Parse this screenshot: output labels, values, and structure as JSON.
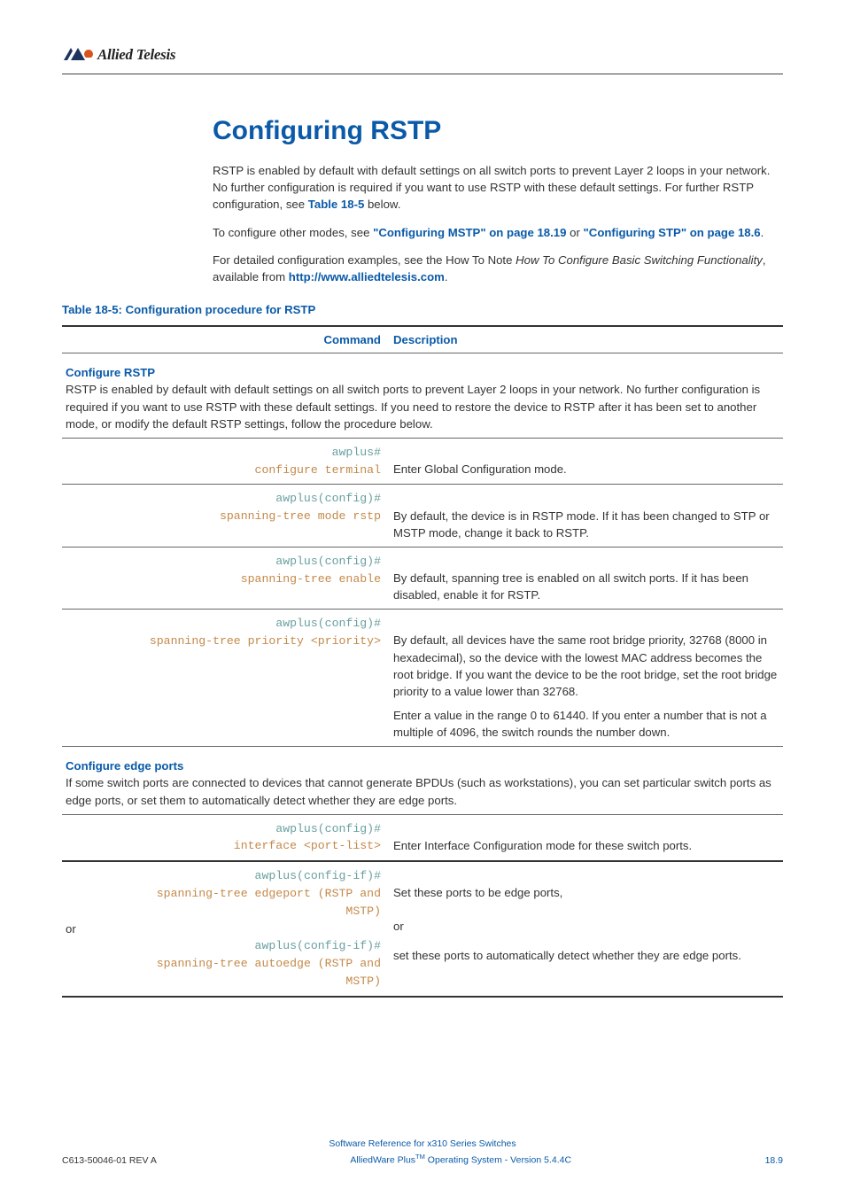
{
  "logo_text": "Allied Telesis",
  "h1": "Configuring RSTP",
  "intro": {
    "p1_a": "RSTP is enabled by default with default settings on all switch ports to prevent Layer 2 loops in your network. No further configuration is required if you want to use RSTP with these default settings. For further RSTP configuration, see ",
    "p1_link": "Table 18-5",
    "p1_b": " below.",
    "p2_a": "To configure other modes, see ",
    "p2_link1": "\"Configuring MSTP\" on page 18.19",
    "p2_b": " or ",
    "p2_link2": "\"Configuring STP\" on page 18.6",
    "p2_c": ".",
    "p3_a": "For detailed configuration examples, see the How To Note ",
    "p3_i": "How To Configure Basic Switching Functionality",
    "p3_b": ", available from ",
    "p3_link": "http://www.alliedtelesis.com",
    "p3_c": "."
  },
  "table_caption": "Table 18-5: Configuration procedure for RSTP",
  "head": {
    "cmd": "Command",
    "desc": "Description"
  },
  "sec1": {
    "title": "Configure RSTP",
    "body": "RSTP is enabled by default with default settings on all switch ports to prevent Layer 2 loops in your network. No further configuration is required if you want to use RSTP with these default settings. If you need to restore the device to RSTP after it has been set to another mode, or modify the default RSTP settings, follow the procedure below."
  },
  "rows": {
    "r1": {
      "prompt": "awplus#",
      "cmd": "configure terminal",
      "desc": "Enter Global Configuration mode."
    },
    "r2": {
      "prompt": "awplus(config)#",
      "cmd": "spanning-tree mode rstp",
      "desc": "By default, the device is in RSTP mode. If it has been changed to STP or MSTP mode, change it back to RSTP."
    },
    "r3": {
      "prompt": "awplus(config)#",
      "cmd": "spanning-tree enable",
      "desc": "By default, spanning tree is enabled on all switch ports. If it has been disabled, enable it for RSTP."
    },
    "r4": {
      "prompt": "awplus(config)#",
      "cmd": "spanning-tree priority <priority>",
      "desc1": "By default, all devices have the same root bridge priority, 32768 (8000 in hexadecimal), so the device with the lowest MAC address becomes the root bridge. If you want the device to be the root bridge, set the root bridge priority to a value lower than 32768.",
      "desc2": "Enter a value in the range 0 to 61440. If you enter a number that is not a multiple of 4096, the switch rounds the number down."
    }
  },
  "sec2": {
    "title": "Configure edge ports",
    "body": "If some switch ports are connected to devices that cannot generate BPDUs (such as workstations), you can set particular switch ports as edge ports, or set them to automatically detect whether they are edge ports."
  },
  "rows2": {
    "r5": {
      "prompt": "awplus(config)#",
      "cmd": "interface <port-list>",
      "desc": "Enter Interface Configuration mode for these switch ports."
    },
    "r6": {
      "prompt1": "awplus(config-if)#",
      "cmd1a": "spanning-tree edgeport (RSTP and",
      "cmd1b": "MSTP)",
      "or": "or",
      "prompt2": "awplus(config-if)#",
      "cmd2a": "spanning-tree autoedge (RSTP and",
      "cmd2b": "MSTP)",
      "desc1": "Set these ports to be edge ports,",
      "desc_or": "or",
      "desc2": "set these ports to automatically detect whether they are edge ports."
    }
  },
  "footer": {
    "line1": "Software Reference for x310 Series Switches",
    "left": "C613-50046-01 REV A",
    "center_a": "AlliedWare Plus",
    "center_tm": "TM",
    "center_b": " Operating System - Version 5.4.4C",
    "right": "18.9"
  }
}
